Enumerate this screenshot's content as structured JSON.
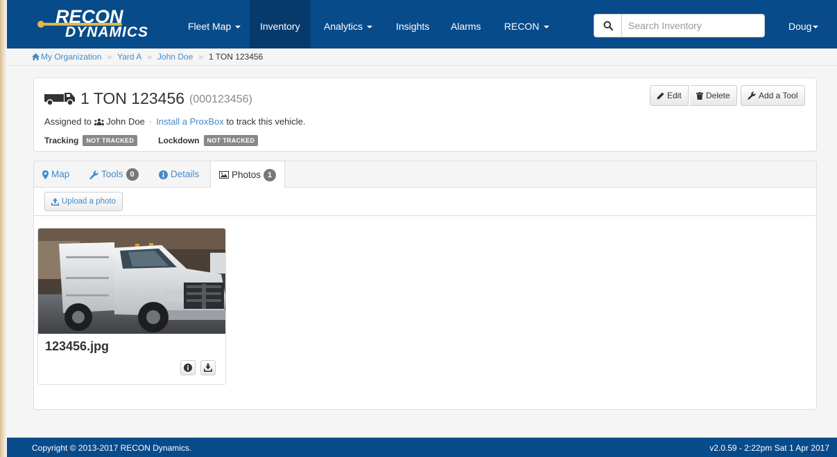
{
  "brand": {
    "line1": "RECON",
    "line2": "DYNAMICS",
    "accent_color": "#e3b54a",
    "nav_color": "#084b8a"
  },
  "nav": {
    "items": [
      {
        "label": "Fleet Map",
        "dropdown": true
      },
      {
        "label": "Inventory",
        "active": true
      },
      {
        "label": "Analytics",
        "dropdown": true
      },
      {
        "label": "Insights"
      },
      {
        "label": "Alarms"
      },
      {
        "label": "RECON",
        "dropdown": true
      }
    ],
    "search_placeholder": "Search Inventory",
    "user": "Doug"
  },
  "breadcrumb": {
    "items": [
      "My Organization",
      "Yard A",
      "John Doe"
    ],
    "separator": "»",
    "current": "1 TON 123456"
  },
  "vehicle": {
    "name": "1 TON 123456",
    "id": "(000123456)",
    "assigned_prefix": "Assigned to",
    "assigned_to": "John Doe",
    "dot": "·",
    "install_link": "Install a ProxBox",
    "install_suffix": "to track this vehicle.",
    "tracking_label": "Tracking",
    "tracking_status": "NOT TRACKED",
    "lockdown_label": "Lockdown",
    "lockdown_status": "NOT TRACKED"
  },
  "actions": {
    "edit": "Edit",
    "delete": "Delete",
    "add_tool": "Add a Tool"
  },
  "tabs": [
    {
      "label": "Map",
      "icon": "map-marker-icon"
    },
    {
      "label": "Tools",
      "icon": "wrench-icon",
      "count": "0"
    },
    {
      "label": "Details",
      "icon": "info-circle-icon"
    },
    {
      "label": "Photos",
      "icon": "picture-icon",
      "count": "1",
      "active": true
    }
  ],
  "photos": {
    "upload_label": "Upload a photo",
    "items": [
      {
        "filename": "123456.jpg"
      }
    ]
  },
  "footer": {
    "copyright": "Copyright © 2013-2017 RECON Dynamics.",
    "version": "v2.0.59 - 2:22pm Sat 1 Apr 2017"
  }
}
